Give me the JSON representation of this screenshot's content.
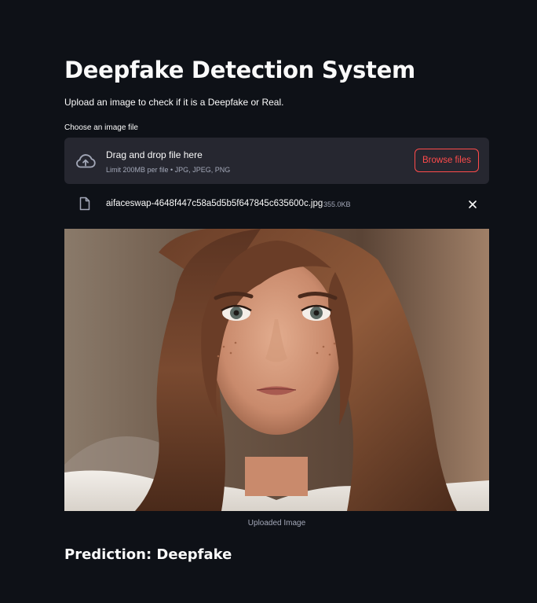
{
  "page": {
    "title": "Deepfake Detection System",
    "subtitle": "Upload an image to check if it is a Deepfake or Real."
  },
  "uploader": {
    "label": "Choose an image file",
    "drop_text": "Drag and drop file here",
    "limit_text": "Limit 200MB per file • JPG, JPEG, PNG",
    "browse_label": "Browse files",
    "icon": "cloud-upload-icon"
  },
  "uploaded_file": {
    "name": "aifaceswap-4648f447c58a5d5b5f647845c635600c.jpg",
    "size": "355.0KB",
    "icon": "file-icon",
    "remove_icon": "close-icon"
  },
  "image": {
    "caption": "Uploaded Image"
  },
  "result": {
    "prediction": "Prediction: Deepfake"
  },
  "colors": {
    "background": "#0e1117",
    "dropzone": "#262730",
    "accent": "#ff4b4b",
    "muted_text": "#a3a8b8"
  }
}
